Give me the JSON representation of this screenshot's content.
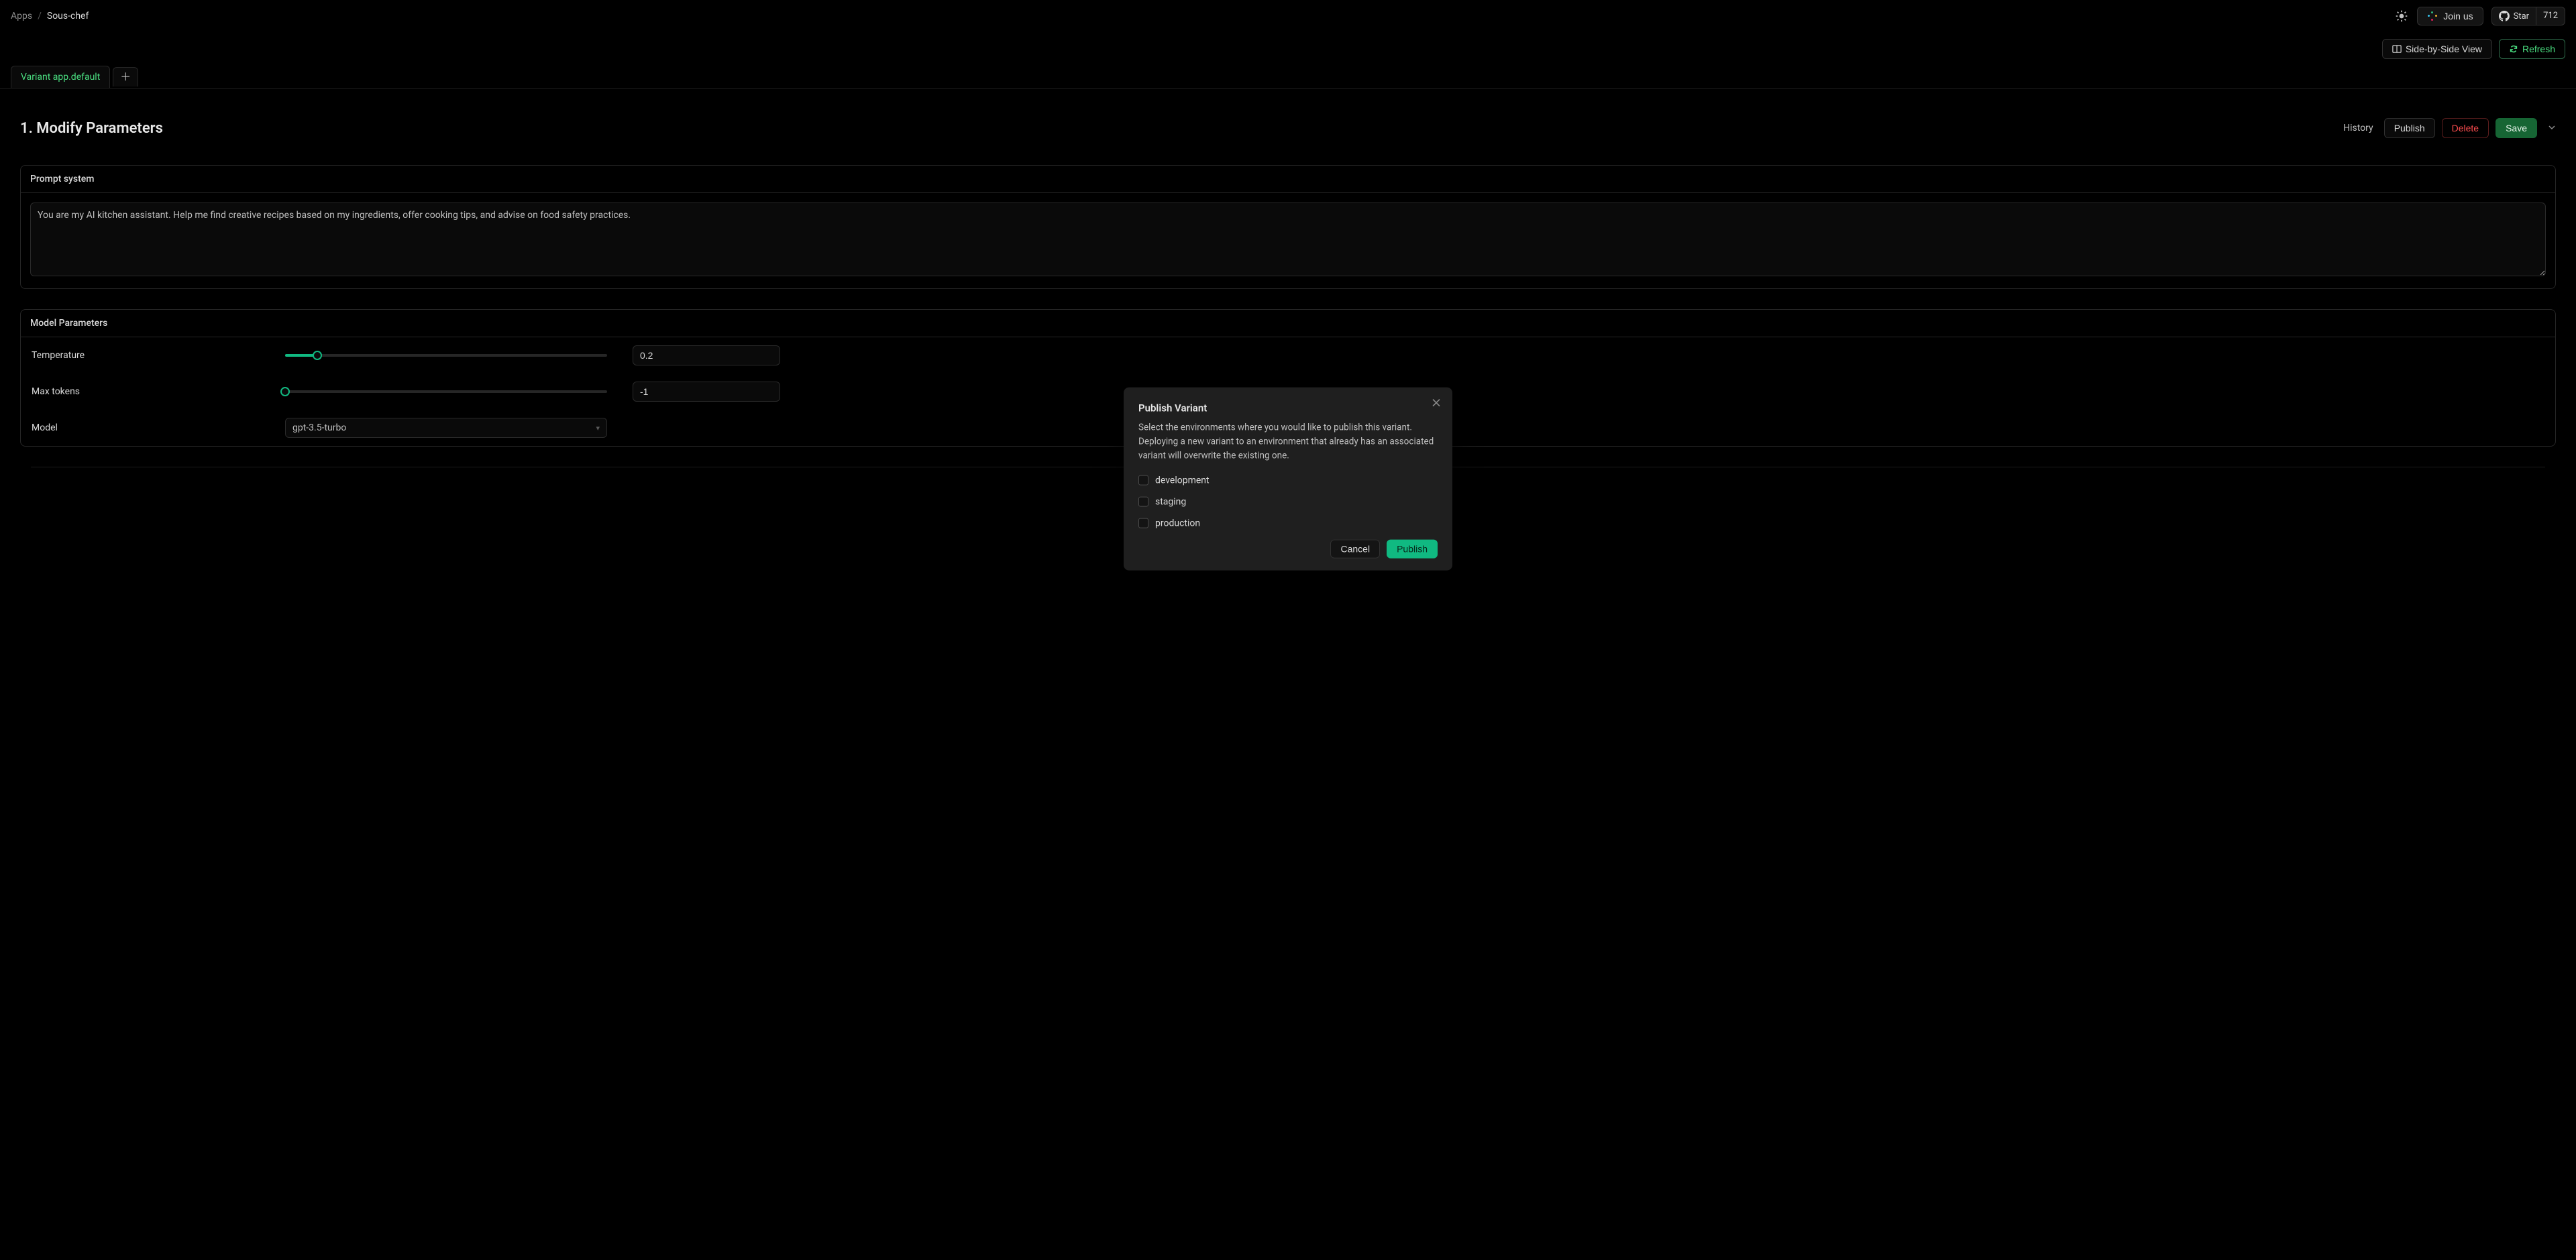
{
  "breadcrumb": {
    "root": "Apps",
    "sep": "/",
    "current": "Sous-chef"
  },
  "topbar": {
    "join_us": "Join us",
    "star": "Star",
    "stars_count": "712"
  },
  "actions": {
    "side_by_side": "Side-by-Side View",
    "refresh": "Refresh"
  },
  "tabs": {
    "variant_label": "Variant app.default"
  },
  "section": {
    "title": "1. Modify Parameters",
    "history": "History",
    "publish": "Publish",
    "delete": "Delete",
    "save": "Save"
  },
  "prompt_panel": {
    "header": "Prompt system",
    "value": "You are my AI kitchen assistant. Help me find creative recipes based on my ingredients, offer cooking tips, and advise on food safety practices."
  },
  "model_panel": {
    "header": "Model Parameters",
    "temperature_label": "Temperature",
    "temperature_value": "0.2",
    "temperature_fill_pct": 10,
    "max_tokens_label": "Max tokens",
    "max_tokens_value": "-1",
    "max_tokens_fill_pct": 0,
    "model_label": "Model",
    "model_value": "gpt-3.5-turbo"
  },
  "modal": {
    "title": "Publish Variant",
    "description": "Select the environments where you would like to publish this variant. Deploying a new variant to an environment that already has an associated variant will overwrite the existing one.",
    "environments": [
      "development",
      "staging",
      "production"
    ],
    "cancel": "Cancel",
    "publish": "Publish"
  }
}
